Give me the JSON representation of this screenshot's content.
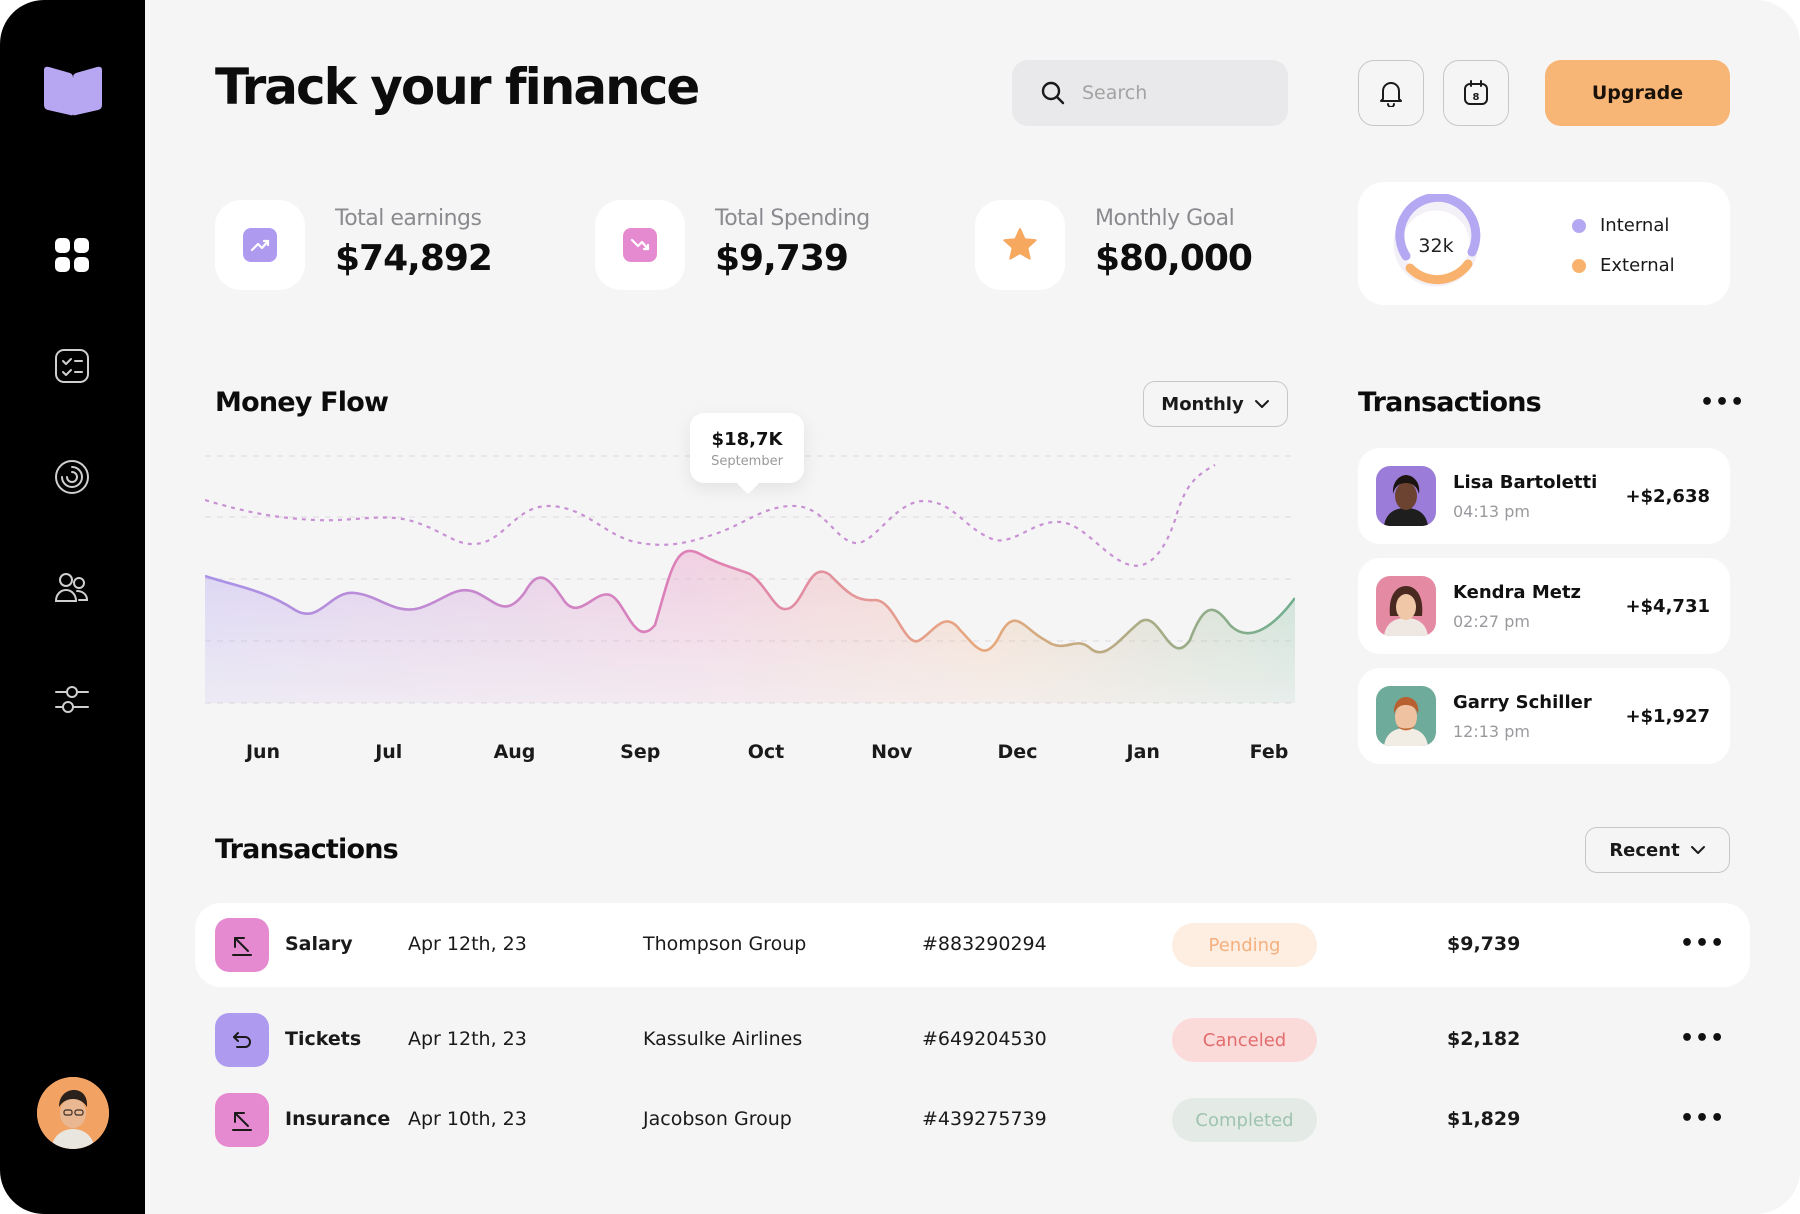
{
  "page_title": "Track your finance",
  "search": {
    "placeholder": "Search"
  },
  "header": {
    "upgrade_label": "Upgrade",
    "calendar_day": "8"
  },
  "stats": [
    {
      "label": "Total earnings",
      "value": "$74,892",
      "icon": "trend-up-icon",
      "color": "#ae9bf0"
    },
    {
      "label": "Total Spending",
      "value": "$9,739",
      "icon": "trend-down-icon",
      "color": "#e58ad0"
    },
    {
      "label": "Monthly Goal",
      "value": "$80,000",
      "icon": "star-icon",
      "color": "#f6a85f"
    }
  ],
  "donut": {
    "center_label": "32k",
    "legend": [
      {
        "label": "Internal",
        "color": "#b5a8f2"
      },
      {
        "label": "External",
        "color": "#f8b26d"
      }
    ]
  },
  "money_flow": {
    "title": "Money Flow",
    "period": "Monthly",
    "tooltip_value": "$18,7K",
    "tooltip_label": "September"
  },
  "chart_data": {
    "type": "area",
    "categories": [
      "Jun",
      "Jul",
      "Aug",
      "Sep",
      "Oct",
      "Nov",
      "Dec",
      "Jan",
      "Feb"
    ],
    "grid": true,
    "colors": {
      "area_start": "#b6a8f0",
      "area_mid": "#e28fb6",
      "area_mid2": "#f0b58a",
      "area_end": "#7bb79a",
      "dashed": "#c79ad6"
    }
  },
  "side_transactions": {
    "title": "Transactions",
    "items": [
      {
        "name": "Lisa Bartoletti",
        "time": "04:13 pm",
        "amount": "+$2,638",
        "avatar_bg": "#9b7cd9"
      },
      {
        "name": "Kendra Metz",
        "time": "02:27 pm",
        "amount": "+$4,731",
        "avatar_bg": "#e58aa3"
      },
      {
        "name": "Garry Schiller",
        "time": "12:13 pm",
        "amount": "+$1,927",
        "avatar_bg": "#6fab9a"
      }
    ]
  },
  "transactions_table": {
    "title": "Transactions",
    "sort": "Recent",
    "rows": [
      {
        "category": "Salary",
        "date": "Apr 12th, 23",
        "party": "Thompson Group",
        "id": "#883290294",
        "status": "Pending",
        "amount": "$9,739",
        "icon": "arrow-up-left-icon",
        "icon_bg": "#e58ad0"
      },
      {
        "category": "Tickets",
        "date": "Apr 12th, 23",
        "party": "Kassulke Airlines",
        "id": "#649204530",
        "status": "Canceled",
        "amount": "$2,182",
        "icon": "return-arrow-icon",
        "icon_bg": "#ae9bf0"
      },
      {
        "category": "Insurance",
        "date": "Apr 10th, 23",
        "party": "Jacobson Group",
        "id": "#439275739",
        "status": "Completed",
        "amount": "$1,829",
        "icon": "arrow-up-left-icon",
        "icon_bg": "#e58ad0"
      }
    ],
    "status_colors": {
      "Pending": {
        "bg": "#fdeee1",
        "fg": "#f4b07e"
      },
      "Canceled": {
        "bg": "#fbdada",
        "fg": "#e26d6d"
      },
      "Completed": {
        "bg": "#e4ebe6",
        "fg": "#9ec3b0"
      }
    }
  }
}
